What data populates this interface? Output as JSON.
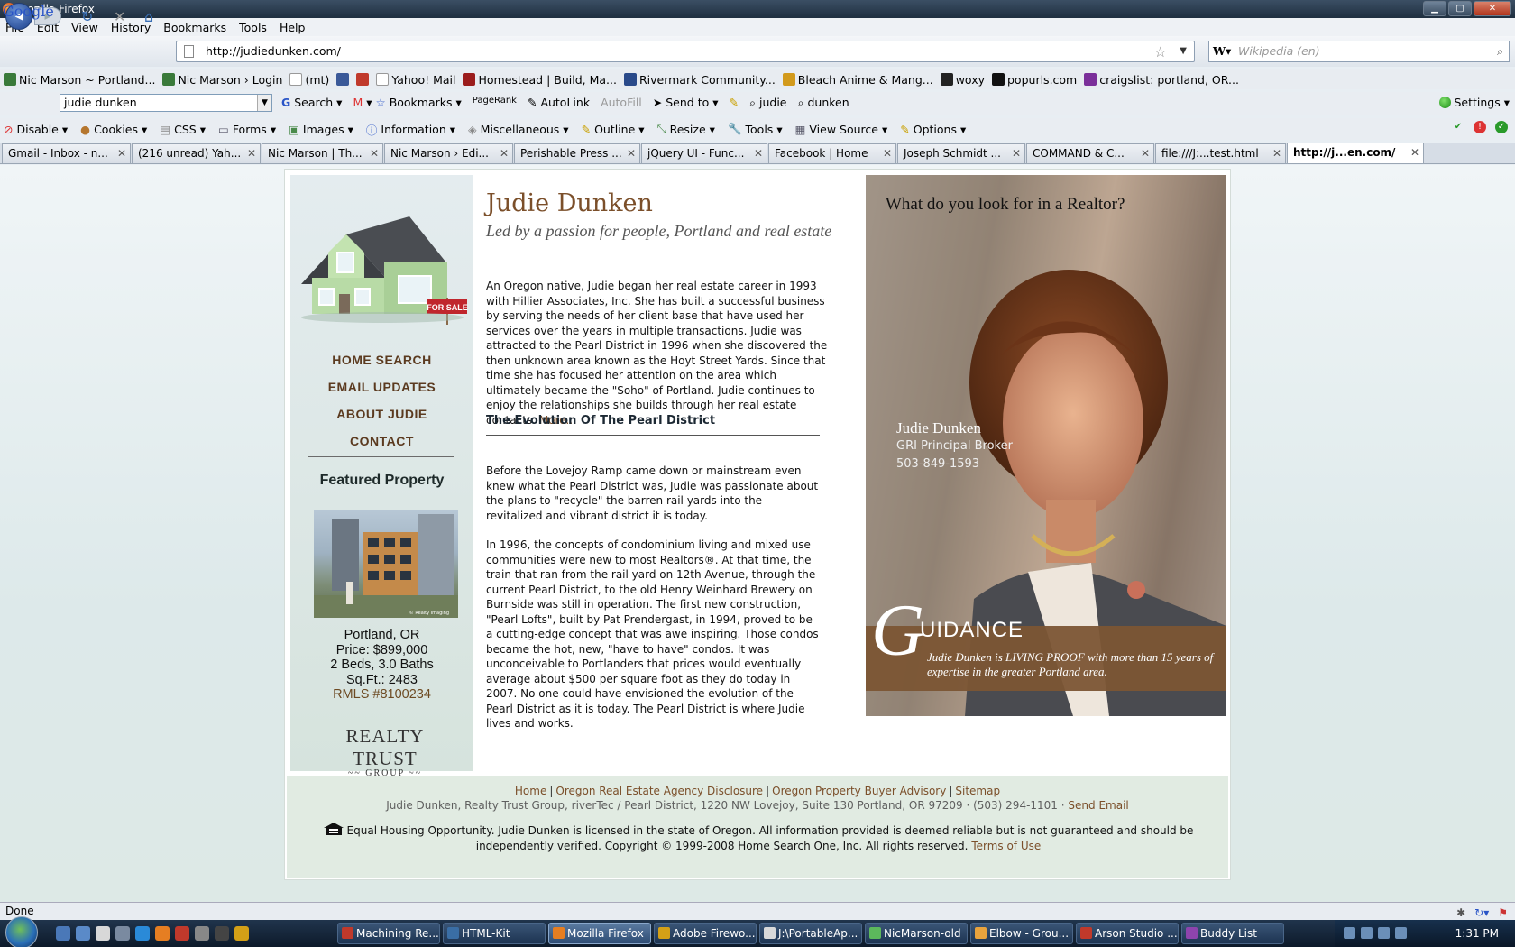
{
  "window": {
    "title": "Mozilla Firefox"
  },
  "menu": [
    "File",
    "Edit",
    "View",
    "History",
    "Bookmarks",
    "Tools",
    "Help"
  ],
  "address": {
    "url": "http://judiedunken.com/",
    "search_placeholder": "Wikipedia (en)"
  },
  "bookmarks": [
    {
      "label": "Nic Marson ~ Portland...",
      "icon": "nm",
      "color": "#3a7a3a"
    },
    {
      "label": "Nic Marson › Login",
      "icon": "nm",
      "color": "#3a7a3a"
    },
    {
      "label": "(mt)",
      "icon": "page",
      "color": "#ffffff"
    },
    {
      "label": "",
      "icon": "f",
      "color": "#3b5998"
    },
    {
      "label": "",
      "icon": "k",
      "color": "#c0392b"
    },
    {
      "label": "Yahoo! Mail",
      "icon": "page",
      "color": "#ffffff"
    },
    {
      "label": "Homestead | Build, Ma...",
      "icon": "h",
      "color": "#9b1c1c"
    },
    {
      "label": "Rivermark Community...",
      "icon": "r",
      "color": "#2a4a8a"
    },
    {
      "label": "Bleach Anime & Mang...",
      "icon": "b",
      "color": "#d29a1c"
    },
    {
      "label": "woxy",
      "icon": "w",
      "color": "#222222"
    },
    {
      "label": "popurls.com",
      "icon": "p",
      "color": "#111111"
    },
    {
      "label": "craigslist: portland, OR...",
      "icon": "peace",
      "color": "#7b2f9a"
    }
  ],
  "google_bar": {
    "logo": "Google",
    "query": "judie dunken",
    "tools": [
      "Search",
      "Bookmarks",
      "PageRank",
      "AutoLink",
      "AutoFill",
      "Send to",
      "judie",
      "dunken"
    ],
    "settings": "Settings"
  },
  "webdev": [
    "Disable",
    "Cookies",
    "CSS",
    "Forms",
    "Images",
    "Information",
    "Miscellaneous",
    "Outline",
    "Resize",
    "Tools",
    "View Source",
    "Options"
  ],
  "tabs": [
    {
      "label": "Gmail - Inbox - n...",
      "active": false
    },
    {
      "label": "(216 unread) Yah...",
      "active": false
    },
    {
      "label": "Nic Marson | Th...",
      "active": false
    },
    {
      "label": "Nic Marson › Edi...",
      "active": false
    },
    {
      "label": "Perishable Press ...",
      "active": false
    },
    {
      "label": "jQuery UI - Func...",
      "active": false
    },
    {
      "label": "Facebook | Home",
      "active": false
    },
    {
      "label": "Joseph Schmidt ...",
      "active": false
    },
    {
      "label": "COMMAND & C...",
      "active": false
    },
    {
      "label": "file:///J:...test.html",
      "active": false
    },
    {
      "label": "http://j...en.com/",
      "active": true
    }
  ],
  "site": {
    "nav": [
      "HOME SEARCH",
      "EMAIL UPDATES",
      "ABOUT JUDIE",
      "CONTACT"
    ],
    "house_sign": "FOR SALE",
    "featured": {
      "heading": "Featured Property",
      "city": "Portland, OR",
      "price": "Price: $899,000",
      "beds": "2 Beds, 3.0 Baths",
      "sqft": "Sq.Ft.: 2483",
      "rmls": "RMLS #8100234",
      "photo_credit": "© Realty Imaging"
    },
    "logo": {
      "line1": "REALTY TRUST",
      "line2": "GROUP"
    },
    "name": "Judie Dunken",
    "tagline": "Led by a passion for people, Portland and real estate",
    "intro": "An Oregon native, Judie began her real estate career in 1993 with Hillier Associates, Inc. She has built a successful business by serving the needs of her client base that have used her services over the years in multiple transactions. Judie was attracted to the Pearl District in 1996 when she discovered the then unknown area known as the Hoyt Street Yards. Since that time she has focused her attention on the area which ultimately became the \"Soho\" of Portland. Judie continues to enjoy the relationships she builds through her real estate contacts.",
    "more": "More...",
    "section_title": "The Evolution Of The Pearl District",
    "para1": "Before the Lovejoy Ramp came down or mainstream even knew what the Pearl District was, Judie was passionate about the plans to \"recycle\" the barren rail yards into the revitalized and vibrant district it is today.",
    "para2": "In 1996, the concepts of condominium living and mixed use communities were new to most Realtors®. At that time, the train that ran from the rail yard on 12th Avenue, through the current Pearl District, to the old Henry Weinhard Brewery on Burnside was still in operation. The first new construction, \"Pearl Lofts\", built by Pat Prendergast, in 1994, proved to be a cutting-edge concept that was awe inspiring. Those condos became the hot, new, \"have to have\" condos. It was unconceivable to Portlanders that prices would eventually average about $500 per square foot as they do today in 2007. No one could have envisioned the evolution of the Pearl District as it is today. The Pearl District is where Judie lives and works.",
    "photo": {
      "question": "What do you look for in a Realtor?",
      "name": "Judie Dunken",
      "credential": "GRI Principal Broker",
      "phone": "503-849-1593",
      "guidance_initial": "G",
      "guidance_rest": "UIDANCE",
      "guidance_text": "Judie Dunken is LIVING PROOF with more than 15 years of expertise in the greater Portland area."
    },
    "footer": {
      "links": [
        "Home",
        "Oregon Real Estate Agency Disclosure",
        "Oregon Property Buyer Advisory",
        "Sitemap"
      ],
      "address": "Judie Dunken, Realty Trust Group, riverTec / Pearl District, 1220 NW Lovejoy, Suite 130 Portland, OR 97209 · (503) 294-1101 ·",
      "send_email": "Send Email",
      "legal": "Equal Housing Opportunity. Judie Dunken is licensed in the state of Oregon. All information provided is deemed reliable but is not guaranteed and should be independently verified. Copyright © 1999-2008 Home Search One, Inc. All rights reserved.",
      "terms": "Terms of Use"
    }
  },
  "status": {
    "text": "Done"
  },
  "taskbar": {
    "tasks": [
      {
        "label": "Machining Re...",
        "color": "#c0392b",
        "active": false
      },
      {
        "label": "HTML-Kit",
        "color": "#3a6ea5",
        "active": false
      },
      {
        "label": "Mozilla Firefox",
        "color": "#e67e22",
        "active": true
      },
      {
        "label": "Adobe Firewo...",
        "color": "#d4a017",
        "active": false
      },
      {
        "label": "J:\\PortableAp...",
        "color": "#d9d9d9",
        "active": false
      },
      {
        "label": "NicMarson-old",
        "color": "#5cb85c",
        "active": false
      },
      {
        "label": "Elbow - Grou...",
        "color": "#e8a33d",
        "active": false
      },
      {
        "label": "Arson Studio ...",
        "color": "#c0392b",
        "active": false
      },
      {
        "label": "Buddy List",
        "color": "#8e44ad",
        "active": false
      }
    ],
    "clock": "1:31 PM"
  }
}
